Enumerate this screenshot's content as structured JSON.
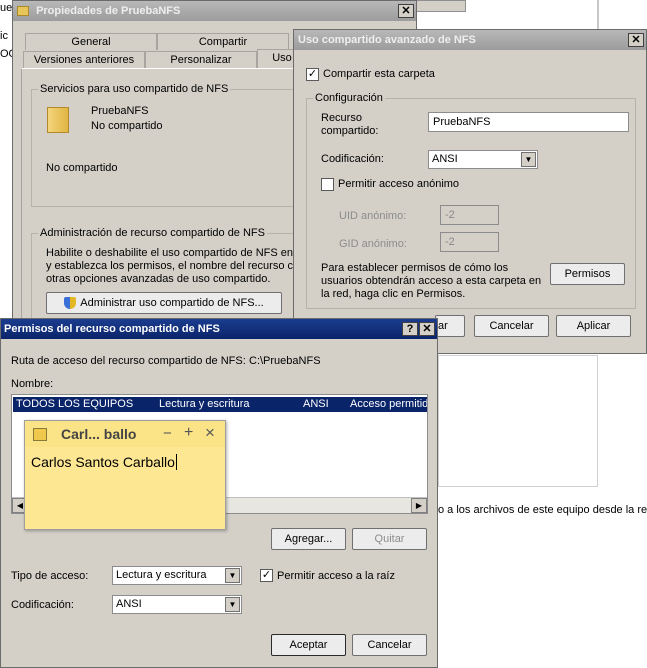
{
  "background": {
    "right_status_text": "o a los archivos de este equipo desde la red",
    "left_clip1": "ue",
    "left_clip2": "ic",
    "left_clip3": "OO"
  },
  "props_window": {
    "title": "Propiedades de PruebaNFS",
    "tabs_row1": [
      "General",
      "Compartir"
    ],
    "tabs_row2": [
      "Versiones anteriores",
      "Personalizar",
      "Uso"
    ],
    "services_group": "Servicios para uso compartido de NFS",
    "folder_name": "PruebaNFS",
    "folder_status": "No compartido",
    "share_status": "No compartido",
    "admin_group": "Administración de recurso compartido de NFS",
    "admin_text": [
      "Habilite o deshabilite el uso compartido de NFS en es",
      "y establezca los permisos, el nombre del recurso com",
      "otras opciones avanzadas de uso compartido."
    ],
    "admin_button": "Administrar uso compartido de NFS..."
  },
  "advanced_window": {
    "title": "Uso compartido avanzado de NFS",
    "share_checkbox": "Compartir esta carpeta",
    "config_group": "Configuración",
    "resource_label": [
      "Recurso",
      "compartido:"
    ],
    "resource_value": "PruebaNFS",
    "encoding_label": "Codificación:",
    "encoding_value": "ANSI",
    "anon_checkbox": "Permitir acceso anónimo",
    "uid_label": "UID anónimo:",
    "uid_value": "-2",
    "gid_label": "GID anónimo:",
    "gid_value": "-2",
    "perm_text": [
      "Para establecer permisos de cómo los",
      "usuarios obtendrán acceso a esta carpeta en",
      "la red, haga clic en Permisos."
    ],
    "perm_button": "Permisos",
    "ok_button_clip": "ar",
    "cancel_button": "Cancelar",
    "apply_button": "Aplicar"
  },
  "perm_window": {
    "title": "Permisos del recurso compartido de NFS",
    "help_btn": "?",
    "path_label": "Ruta de acceso del recurso compartido de NFS:",
    "path_value": "C:\\PruebaNFS",
    "name_label": "Nombre:",
    "row": [
      "TODOS LOS EQUIPOS",
      "Lectura y escritura",
      "ANSI",
      "Acceso permitido"
    ],
    "add_button": "Agregar...",
    "remove_button": "Quitar",
    "access_label": "Tipo de acceso:",
    "access_value": "Lectura y escritura",
    "root_checkbox": "Permitir acceso a la raíz",
    "encoding_label": "Codificación:",
    "encoding_value": "ANSI",
    "ok_button": "Aceptar",
    "cancel_button": "Cancelar"
  },
  "sticky_note": {
    "title": "Carl... ballo",
    "minimize": "−",
    "add": "+",
    "close": "×",
    "content": "Carlos Santos Carballo"
  }
}
